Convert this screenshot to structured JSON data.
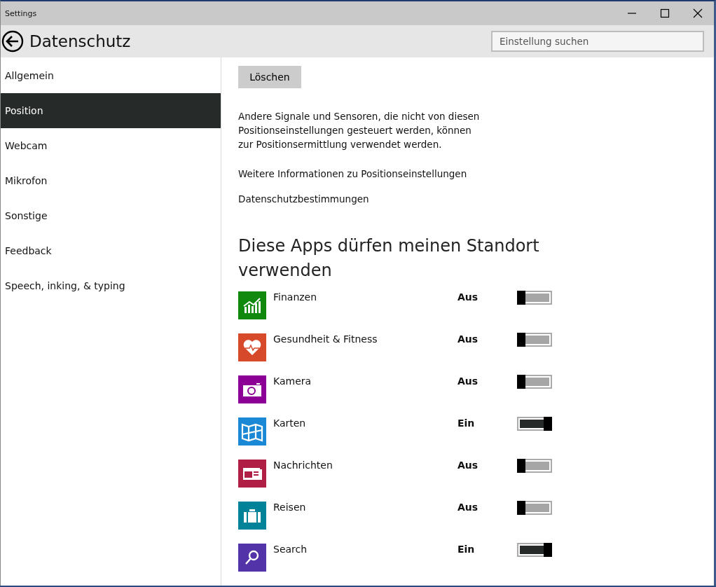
{
  "window": {
    "title": "Settings"
  },
  "header": {
    "title": "Datenschutz",
    "search": {
      "placeholder": "Einstellung suchen"
    }
  },
  "sidebar": {
    "items": [
      {
        "label": "Allgemein",
        "selected": false
      },
      {
        "label": "Position",
        "selected": true
      },
      {
        "label": "Webcam",
        "selected": false
      },
      {
        "label": "Mikrofon",
        "selected": false
      },
      {
        "label": "Sonstige",
        "selected": false
      },
      {
        "label": "Feedback",
        "selected": false
      },
      {
        "label": "Speech, inking, & typing",
        "selected": false
      }
    ]
  },
  "content": {
    "clear_button": "Löschen",
    "info": "Andere Signale und Sensoren, die nicht von diesen Positionseinstellungen gesteuert werden, können zur Positionsermittlung verwendet werden.",
    "links": [
      "Weitere Informationen zu Positionseinstellungen",
      "Datenschutzbestimmungen"
    ],
    "apps_heading": "Diese Apps dürfen meinen Standort verwenden",
    "apps": [
      {
        "name": "Finanzen",
        "color": "#10890e",
        "status": "Aus",
        "on": false
      },
      {
        "name": "Gesundheit & Fitness",
        "color": "#d6492a",
        "status": "Aus",
        "on": false
      },
      {
        "name": "Kamera",
        "color": "#8c0095",
        "status": "Aus",
        "on": false
      },
      {
        "name": "Karten",
        "color": "#1a88d4",
        "status": "Ein",
        "on": true
      },
      {
        "name": "Nachrichten",
        "color": "#b01e45",
        "status": "Aus",
        "on": false
      },
      {
        "name": "Reisen",
        "color": "#008299",
        "status": "Aus",
        "on": false
      },
      {
        "name": "Search",
        "color": "#5234a8",
        "status": "Ein",
        "on": true
      }
    ]
  }
}
